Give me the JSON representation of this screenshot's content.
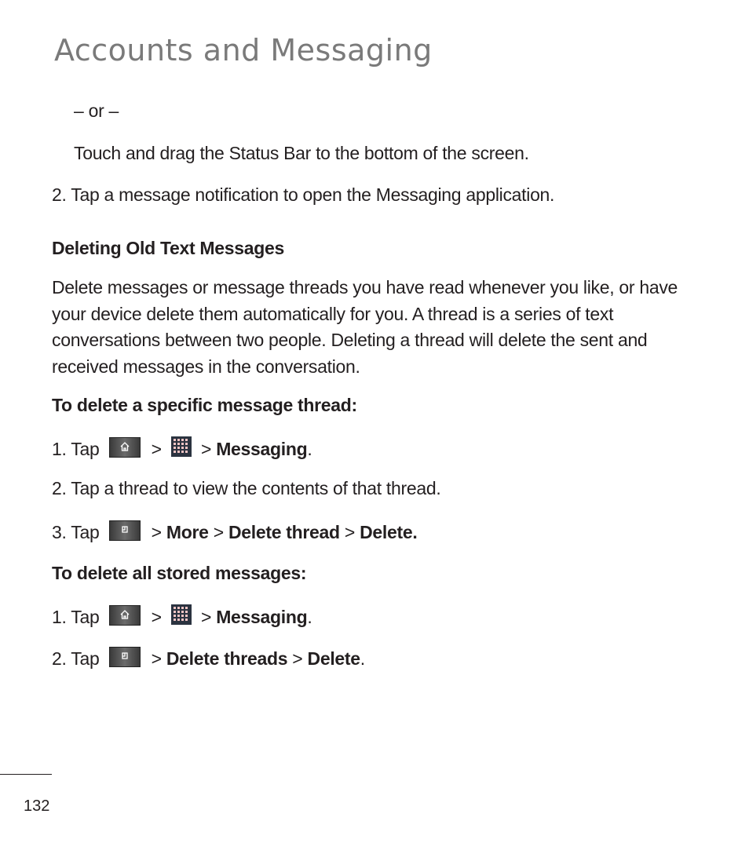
{
  "page": {
    "title": "Accounts and Messaging",
    "page_number": "132"
  },
  "intro": {
    "or": "– or –",
    "drag_text": "Touch and drag the Status Bar to the bottom of the screen.",
    "step2": "2. Tap a message notification to open the Messaging application."
  },
  "section": {
    "heading": "Deleting Old Text Messages",
    "body": "Delete messages or message threads you have read whenever you like, or have your device delete them automatically for you. A thread is a series of text conversations between two people. Deleting a thread will delete the sent and received messages in the conversation."
  },
  "specific": {
    "heading": "To delete a specific message thread:",
    "step1": {
      "prefix": "1. Tap",
      "sep": ">",
      "sep2": ">",
      "target": "Messaging",
      "end": "."
    },
    "step2": "2. Tap a thread to view the contents of that thread.",
    "step3": {
      "prefix": "3. Tap",
      "sep1": ">",
      "item1": "More",
      "sep2": ">",
      "item2": "Delete thread",
      "sep3": ">",
      "item3": "Delete."
    }
  },
  "all": {
    "heading": "To delete all stored messages:",
    "step1": {
      "prefix": "1. Tap",
      "sep": ">",
      "sep2": ">",
      "target": "Messaging",
      "end": "."
    },
    "step2": {
      "prefix": "2. Tap",
      "sep1": ">",
      "item1": "Delete threads",
      "sep2": ">",
      "item2": "Delete",
      "end": "."
    }
  },
  "icons": {
    "home": "home-key-icon",
    "apps": "apps-grid-icon",
    "menu": "menu-key-icon"
  }
}
